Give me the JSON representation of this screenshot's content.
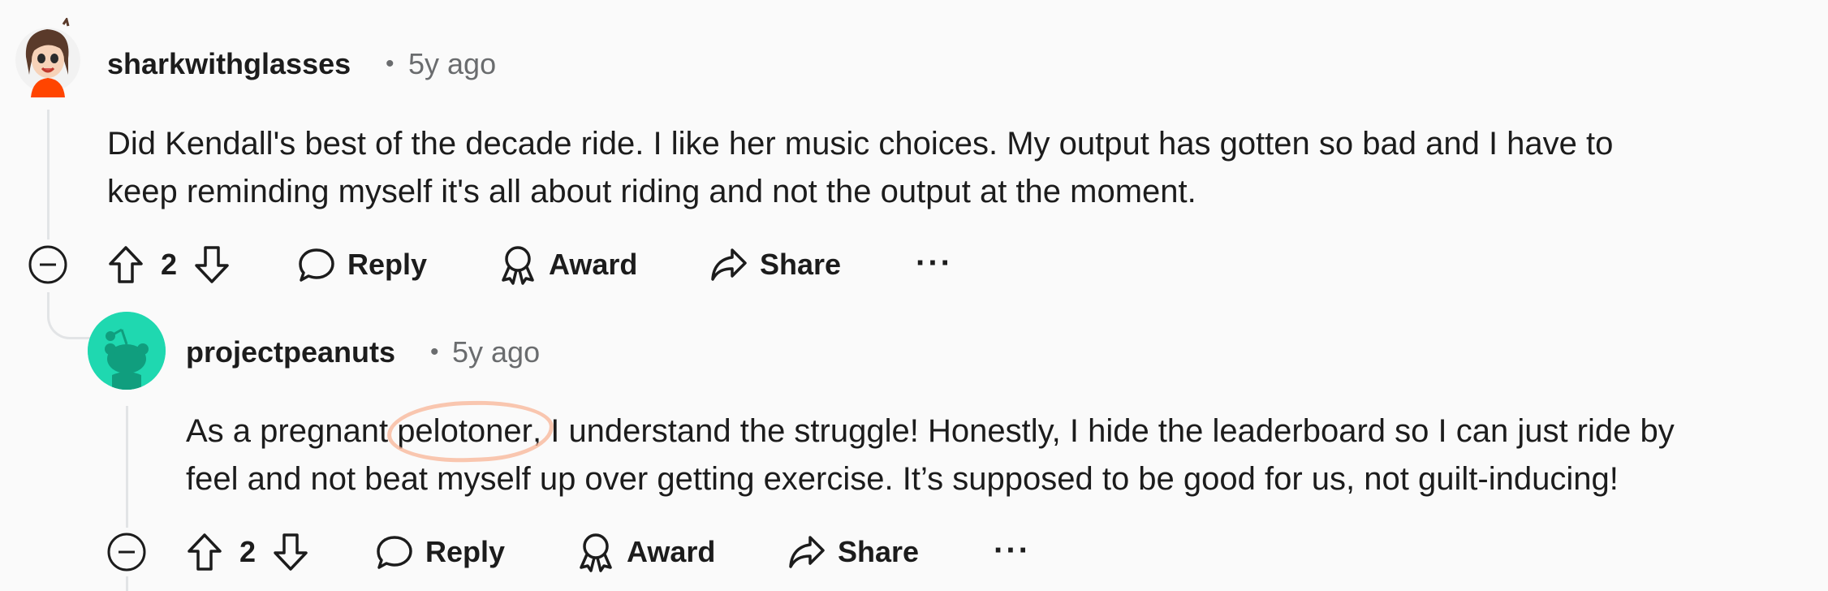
{
  "comments": [
    {
      "username": "sharkwithglasses",
      "separator": "•",
      "time": "5y ago",
      "body_line1": "Did Kendall's best of the decade ride. I like her music choices. My output has gotten so bad and I have to",
      "body_line2": "keep reminding myself it's all about riding and not the output at the moment.",
      "score": "2",
      "reply_label": "Reply",
      "award_label": "Award",
      "share_label": "Share",
      "more_label": "···"
    },
    {
      "username": "projectpeanuts",
      "separator": "•",
      "time": "5y ago",
      "body_line1_pre": "As a pregnant ",
      "body_line1_highlight": "pelotoner",
      "body_line1_post": ", I understand the struggle! Honestly, I hide the leaderboard so I can just ride by",
      "body_line2": "feel and not beat myself up over getting exercise. It’s supposed to be good for us, not guilt-inducing!",
      "score": "2",
      "reply_label": "Reply",
      "award_label": "Award",
      "share_label": "Share",
      "more_label": "···"
    }
  ],
  "colors": {
    "background": "#fafafa",
    "thread_line": "#e2e4e6",
    "meta_gray": "#6a6c6e",
    "highlight_ring": "#f8b496",
    "avatar2_teal": "#1fd8b0"
  },
  "icons": [
    "collapse-icon",
    "upvote-icon",
    "downvote-icon",
    "reply-icon",
    "award-icon",
    "share-icon",
    "more-icon"
  ]
}
